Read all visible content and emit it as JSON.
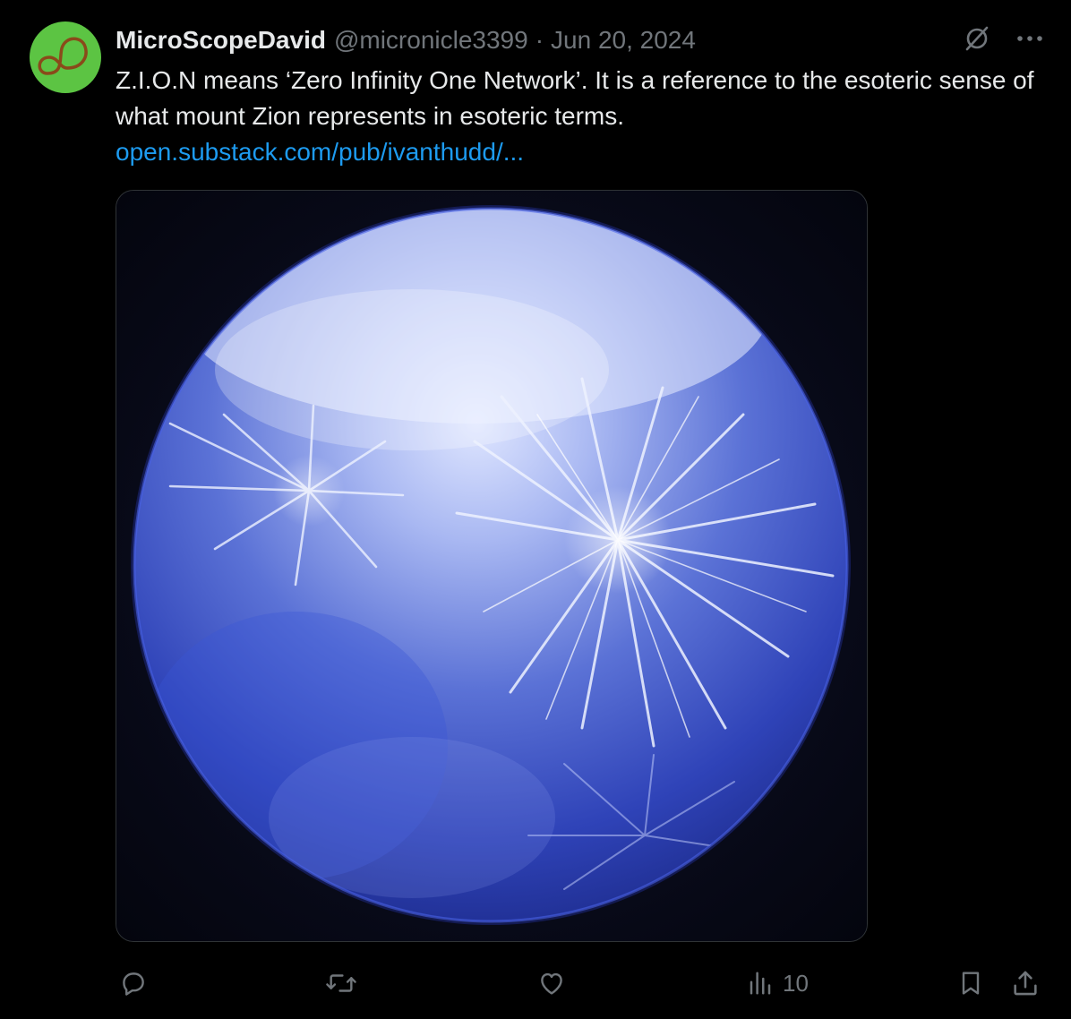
{
  "author": {
    "display_name": "MicroScopeDavid",
    "handle": "@micronicle3399",
    "separator": "·",
    "date": "Jun 20, 2024",
    "avatar_color": "#5cc443"
  },
  "tweet": {
    "text": "Z.I.O.N means ‘Zero Infinity One Network’. It is a reference to the esoteric sense of what mount Zion represents in esoteric terms.",
    "link": "open.substack.com/pub/ivanthudd/...",
    "link_color": "#1d9bf0"
  },
  "media": {
    "alt": "Microscope photograph of blue-lit radiating crystal formations"
  },
  "header_icons": [
    "grok-icon",
    "more-icon"
  ],
  "actions": {
    "reply_icon": "reply-icon",
    "retweet_icon": "retweet-icon",
    "like_icon": "heart-icon",
    "views_icon": "views-icon",
    "views_count": "10",
    "bookmark_icon": "bookmark-icon",
    "share_icon": "share-icon"
  },
  "colors": {
    "background": "#000000",
    "text_primary": "#e7e9ea",
    "text_secondary": "#71767b",
    "border": "#2f3336"
  }
}
